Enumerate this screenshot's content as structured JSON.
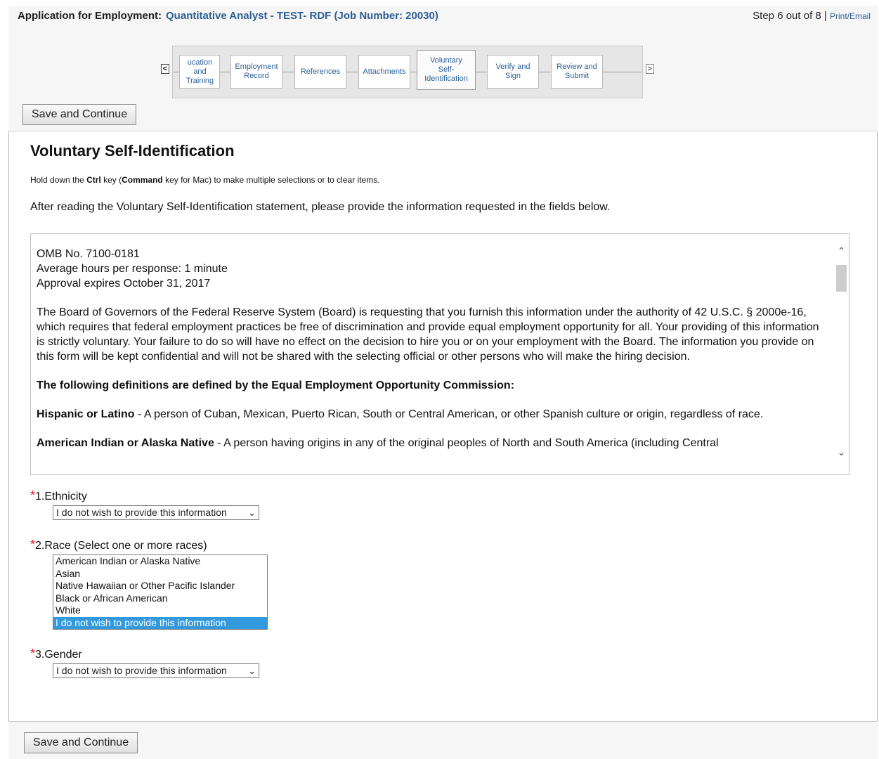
{
  "header": {
    "label": "Application for Employment:",
    "job_title": "Quantitative Analyst - TEST- RDF (Job Number: 20030)",
    "step_text": "Step 6 out of 8 |",
    "print_link": "Print/Email"
  },
  "steps": {
    "prev_arrow": "<",
    "next_arrow": ">",
    "items": [
      {
        "line1": "ucation and",
        "line2": "Training"
      },
      {
        "line1": "Employment",
        "line2": "Record"
      },
      {
        "line1": "References",
        "line2": ""
      },
      {
        "line1": "Attachments",
        "line2": ""
      },
      {
        "line1": "Voluntary",
        "line2": "Self-",
        "line3": "Identification"
      },
      {
        "line1": "Verify and",
        "line2": "Sign"
      },
      {
        "line1": "Review and",
        "line2": "Submit"
      }
    ]
  },
  "buttons": {
    "save_continue_top": "Save and Continue",
    "save_continue_bottom": "Save and Continue"
  },
  "page": {
    "title": "Voluntary Self-Identification",
    "hint_part1": "Hold down the ",
    "hint_ctrl": "Ctrl",
    "hint_part2": " key (",
    "hint_cmd": "Command",
    "hint_part3": " key for Mac) to make multiple selections or to clear items.",
    "intro": "After reading the Voluntary Self-Identification statement, please provide the information requested in the fields below."
  },
  "statement": {
    "omb": "OMB No. 7100-0181",
    "hours": "Average hours per response: 1 minute",
    "expires": "Approval expires October 31, 2017",
    "body": "The Board of Governors of the Federal Reserve System (Board) is requesting that you furnish this information under the authority of 42 U.S.C. § 2000e-16, which requires that federal employment practices be free of discrimination and provide equal employment opportunity for all. Your providing of this information is strictly voluntary. Your failure to do so will have no effect on the decision to hire you or on your employment with the Board. The information you provide on this form will be kept confidential and will not be shared with the selecting official or other persons who will make the hiring decision.",
    "definitions_heading": "The following definitions are defined by the Equal Employment Opportunity Commission:",
    "hispanic_term": "Hispanic or Latino",
    "hispanic_def": " - A person of Cuban, Mexican, Puerto Rican, South or Central American, or other Spanish culture or origin, regardless of race.",
    "aian_term": "American Indian or Alaska Native",
    "aian_def": " - A person having origins in any of the original peoples of North and South America (including Central"
  },
  "questions": {
    "ethnicity_label": "1.Ethnicity",
    "ethnicity_value": "I do not wish to provide this information",
    "race_label": "2.Race (Select one or more races)",
    "race_options": [
      "American Indian or Alaska Native",
      "Asian",
      "Native Hawaiian or Other Pacific Islander",
      "Black or African American",
      "White",
      "I do not wish to provide this information"
    ],
    "race_selected": "I do not wish to provide this information",
    "gender_label": "3.Gender",
    "gender_value": "I do not wish to provide this information",
    "required_mark": "*"
  }
}
